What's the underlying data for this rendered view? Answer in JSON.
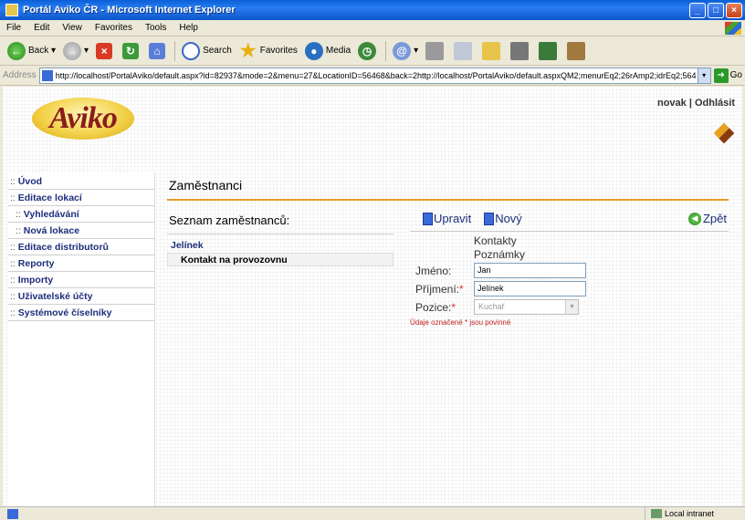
{
  "window": {
    "title": "Portál Aviko ČR - Microsoft Internet Explorer"
  },
  "menu": [
    "File",
    "Edit",
    "View",
    "Favorites",
    "Tools",
    "Help"
  ],
  "toolbar": {
    "back": "Back",
    "search": "Search",
    "favorites": "Favorites",
    "media": "Media"
  },
  "address": {
    "label": "Address",
    "url": "http://localhost/PortalAviko/default.aspx?id=82937&mode=2&menu=27&LocationID=56468&back=2http://localhost/PortalAviko/default.aspxQM2;menurEq2;26rAmp2;idrEq2;564",
    "go": "Go"
  },
  "header": {
    "logo": "Aviko",
    "user": "novak",
    "sep": "|",
    "logout": "Odhlásit"
  },
  "sidebar": {
    "items": [
      {
        "prefix": ":: ",
        "label": "Úvod"
      },
      {
        "prefix": ":: ",
        "label": "Editace lokací"
      },
      {
        "prefix": ":: ",
        "label": "Vyhledávání"
      },
      {
        "prefix": ":: ",
        "label": "Nová lokace"
      },
      {
        "prefix": ":: ",
        "label": "Editace distributorů"
      },
      {
        "prefix": ":: ",
        "label": "Reporty"
      },
      {
        "prefix": ":: ",
        "label": "Importy"
      },
      {
        "prefix": ":: ",
        "label": "Uživatelské účty"
      },
      {
        "prefix": ":: ",
        "label": "Systémové číselníky"
      }
    ]
  },
  "main": {
    "title": "Zaměstnanci",
    "list_title": "Seznam zaměstnanců:",
    "employees": [
      "Jelínek",
      "Kontakt na provozovnu"
    ],
    "actions": {
      "edit": "Upravit",
      "new": "Nový",
      "back": "Zpět"
    },
    "tabs": [
      "Kontakty",
      "Poznámky"
    ],
    "form": {
      "jmeno_label": "Jméno:",
      "jmeno_value": "Jan",
      "prijmeni_label": "Příjmení:",
      "prijmeni_value": "Jelínek",
      "pozice_label": "Pozice:",
      "pozice_value": "Kuchař",
      "req_mark": "*"
    },
    "note": "Údaje označené * jsou povinné"
  },
  "status": {
    "zone": "Local intranet"
  }
}
